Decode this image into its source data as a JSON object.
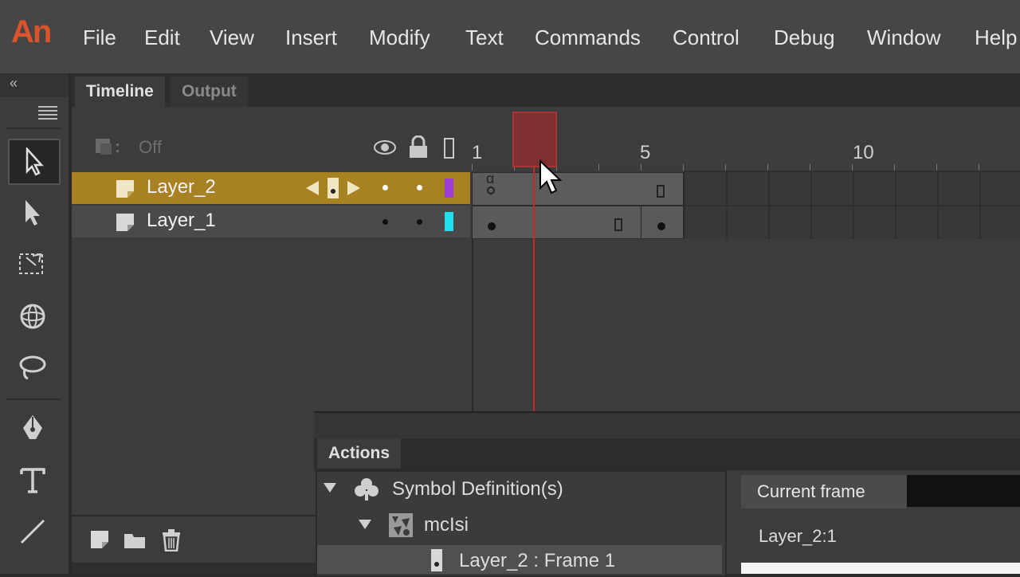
{
  "app": {
    "logo": "An"
  },
  "menu": [
    "File",
    "Edit",
    "View",
    "Insert",
    "Modify",
    "Text",
    "Commands",
    "Control",
    "Debug",
    "Window",
    "Help"
  ],
  "tools_header": {
    "collapse": "«"
  },
  "timeline": {
    "tabs": [
      "Timeline",
      "Output"
    ],
    "onion_skin": "Off",
    "ruler": [
      "1",
      "5",
      "10"
    ],
    "current_frame": 2,
    "layers": [
      {
        "name": "Layer_2",
        "selected": true,
        "color": "#9b3dd6"
      },
      {
        "name": "Layer_1",
        "selected": false,
        "color": "#1fe0f0"
      }
    ],
    "frame_markers": {
      "layer2_label": "α"
    }
  },
  "actions": {
    "tab": "Actions",
    "tree": {
      "symbol_definitions": "Symbol Definition(s)",
      "symbol_name": "mcIsi",
      "frame_entry": "Layer_2 : Frame 1"
    },
    "current_frame_tab": "Current frame",
    "location": "Layer_2:1"
  },
  "colors": {
    "accent_selected_layer": "#a88122",
    "playhead": "#c42828",
    "logo": "#d9542a"
  }
}
